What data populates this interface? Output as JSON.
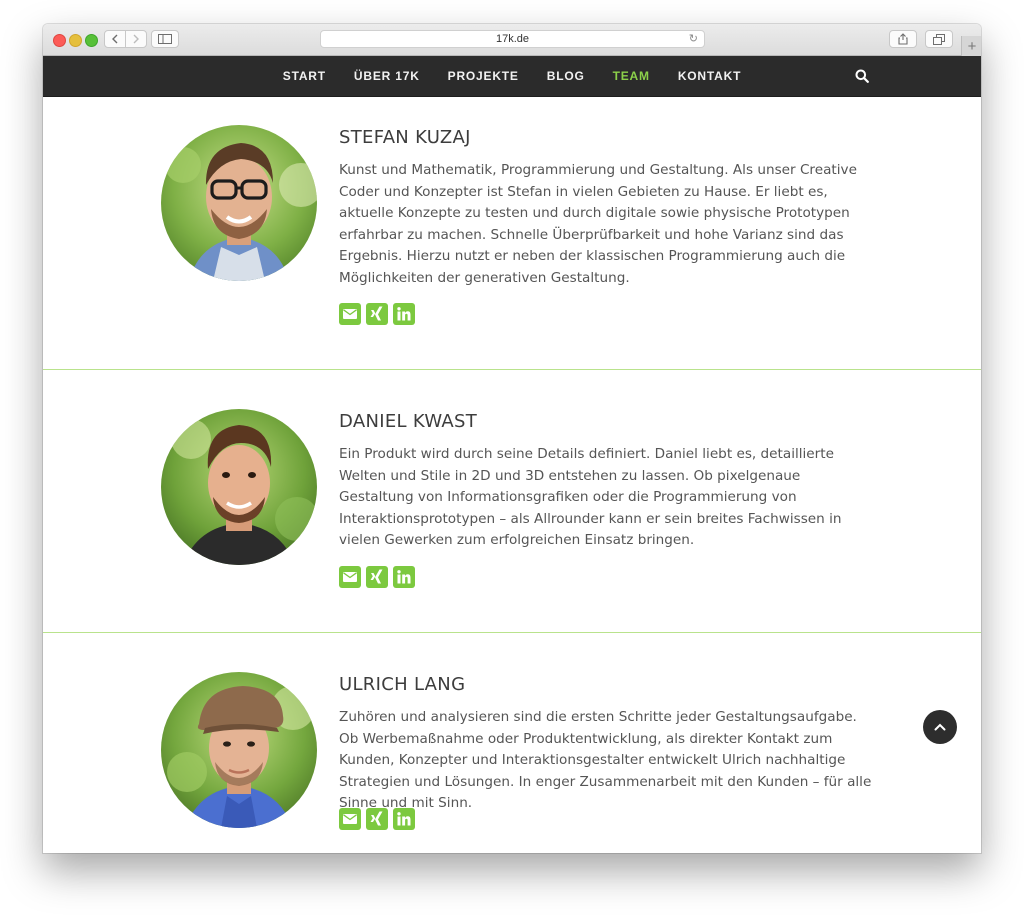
{
  "browser": {
    "url": "17k.de"
  },
  "nav": {
    "items": [
      {
        "label": "START"
      },
      {
        "label": "ÜBER 17K"
      },
      {
        "label": "PROJEKTE"
      },
      {
        "label": "BLOG"
      },
      {
        "label": "TEAM",
        "active": true
      },
      {
        "label": "KONTAKT"
      }
    ],
    "active_color": "#8cd14a"
  },
  "team": [
    {
      "name": "STEFAN KUZAJ",
      "bio": "Kunst und Mathematik, Programmierung und Gestaltung. Als unser Creative Coder und Konzepter ist Stefan in vielen Gebieten zu Hause. Er liebt es, aktuelle Konzepte zu testen und durch digitale sowie physische Prototypen erfahrbar zu machen. Schnelle Überprüfbarkeit und hohe Varianz sind das Ergebnis. Hierzu nutzt er neben der klassischen Programmierung auch die Möglichkeiten der generativen Gestaltung.",
      "socials": [
        "mail-icon",
        "xing-icon",
        "linkedin-icon"
      ]
    },
    {
      "name": "DANIEL KWAST",
      "bio": "Ein Produkt wird durch seine Details definiert. Daniel liebt es, detaillierte Welten und Stile in 2D und 3D entstehen zu lassen. Ob pixelgenaue Gestaltung von Informationsgrafiken oder die Programmierung von Interaktionsprototypen – als Allrounder kann er sein breites Fachwissen in vielen Gewerken zum erfolgreichen Einsatz bringen.",
      "socials": [
        "mail-icon",
        "xing-icon",
        "linkedin-icon"
      ]
    },
    {
      "name": "ULRICH LANG",
      "bio": "Zuhören und analysieren sind die ersten Schritte jeder Gestaltungsaufgabe. Ob Werbemaßnahme oder Produktentwicklung, als direkter Kontakt zum Kunden, Konzepter und Interaktionsgestalter entwickelt Ulrich nachhaltige Strategien und Lösungen. In enger Zusammenarbeit mit den Kunden – für alle Sinne und mit Sinn.",
      "socials": [
        "mail-icon",
        "xing-icon",
        "linkedin-icon"
      ]
    }
  ],
  "colors": {
    "accent": "#7cc93f",
    "divider": "#b9e38c",
    "nav_bg": "#2b2b2b"
  }
}
